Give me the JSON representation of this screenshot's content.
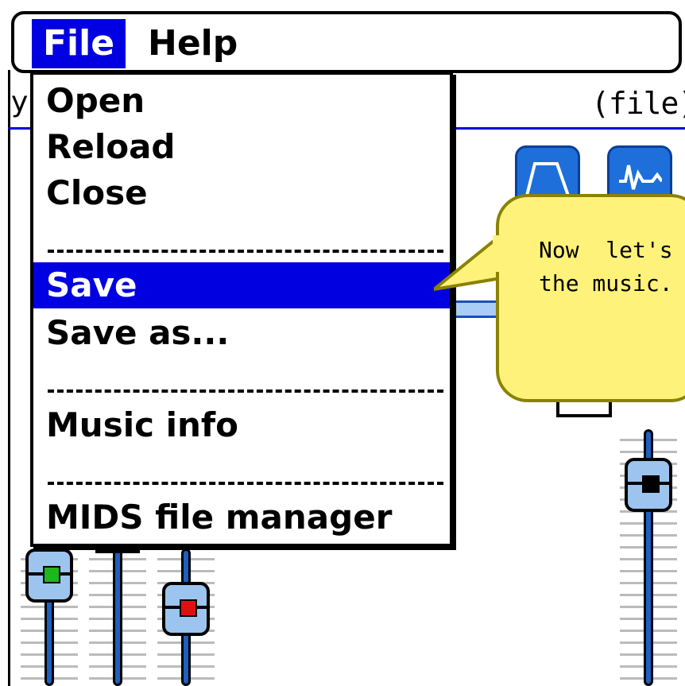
{
  "menubar": {
    "file_label": "File",
    "help_label": "Help"
  },
  "file_menu": {
    "items": [
      {
        "label": "Open"
      },
      {
        "label": "Reload"
      },
      {
        "label": "Close"
      },
      {
        "label": "Save",
        "selected": true
      },
      {
        "label": "Save as..."
      },
      {
        "label": "Music info"
      },
      {
        "label": "MIDS file manager"
      }
    ]
  },
  "background": {
    "file_indicator": "(file)",
    "edge_fragment": "y",
    "tool_buttons": [
      {
        "icon": "envelope-shape-icon"
      },
      {
        "icon": "waveform-icon"
      }
    ],
    "faders": [
      {
        "led_color": "#1fb51f"
      },
      {
        "led_color": "#e01010"
      },
      {
        "led_color": "#000000"
      }
    ]
  },
  "tooltip": {
    "text": "Now  let's\nthe music."
  },
  "colors": {
    "selection": "#0000e0",
    "accent_rule": "#0000dd",
    "bubble_fill": "#fff27a",
    "button_blue": "#1e6fd9"
  }
}
